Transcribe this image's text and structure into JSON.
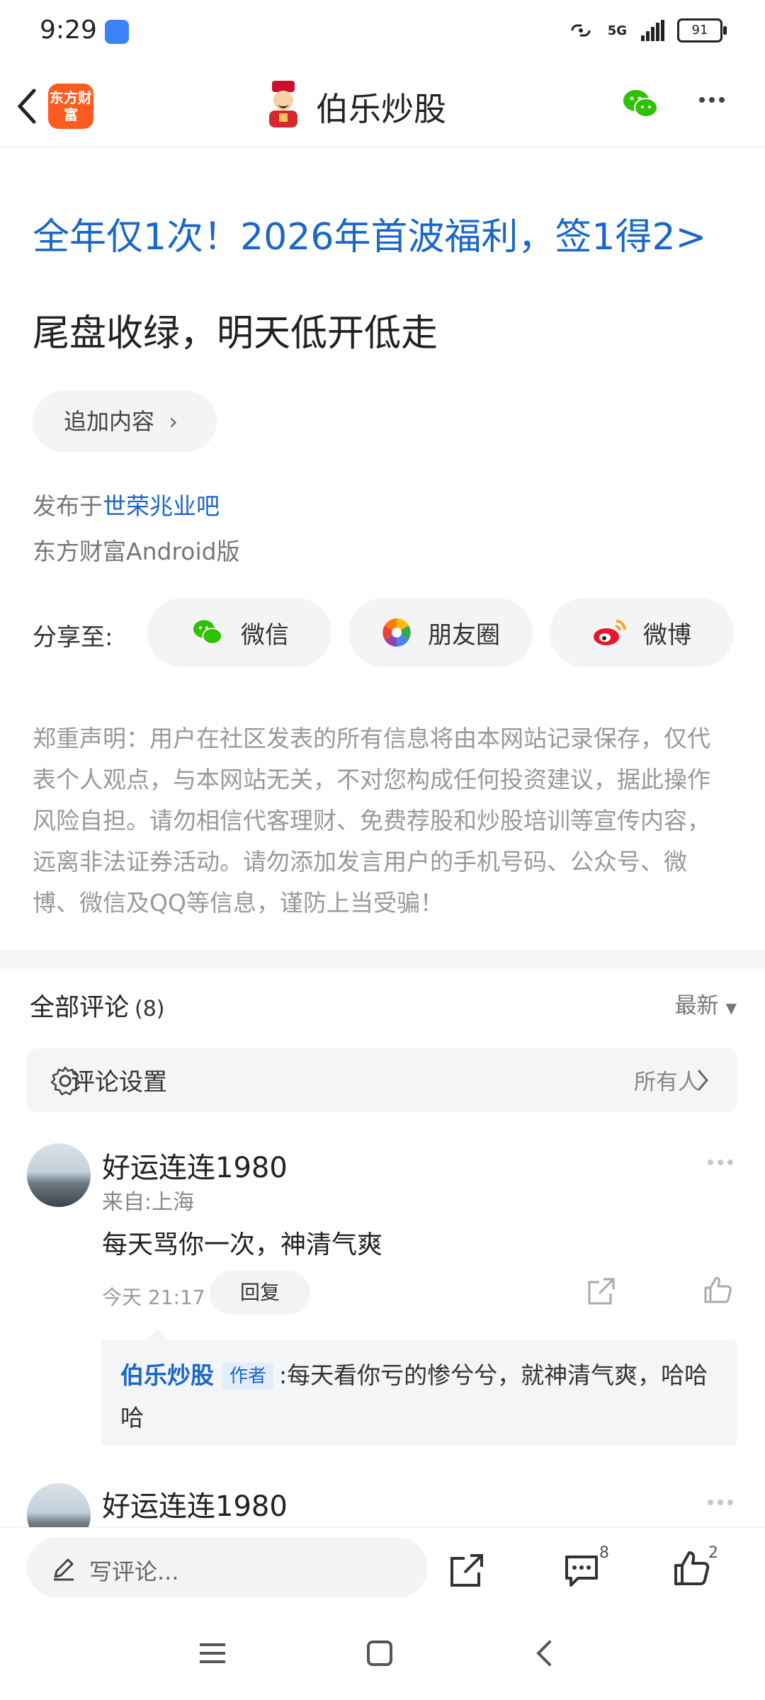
{
  "status_bar": {
    "time": "9:29",
    "network": "5G",
    "battery": "91"
  },
  "header": {
    "logo_text": "东方财富",
    "title": "伯乐炒股"
  },
  "post": {
    "promo": "全年仅1次！2026年首波福利，签1得2>",
    "title": "尾盘收绿，明天低开低走",
    "add_content": "追加内容",
    "published_prefix": "发布于",
    "bar_name": "世荣兆业吧",
    "client": "东方财富Android版"
  },
  "share": {
    "label": "分享至:",
    "items": [
      {
        "label": "微信",
        "icon": "wechat-icon"
      },
      {
        "label": "朋友圈",
        "icon": "moments-icon"
      },
      {
        "label": "微博",
        "icon": "weibo-icon"
      }
    ]
  },
  "disclaimer": "郑重声明：用户在社区发表的所有信息将由本网站记录保存，仅代表个人观点，与本网站无关，不对您构成任何投资建议，据此操作风险自担。请勿相信代客理财、免费荐股和炒股培训等宣传内容，远离非法证券活动。请勿添加发言用户的手机号码、公众号、微博、微信及QQ等信息，谨防上当受骗！",
  "comments": {
    "title": "全部评论",
    "count": "(8)",
    "sort": "最新",
    "settings_label": "评论设置",
    "settings_value": "所有人",
    "items": [
      {
        "user": "好运连连1980",
        "location": "来自:上海",
        "text": "每天骂你一次，神清气爽",
        "time": "今天 21:17",
        "reply_label": "回复",
        "reply": {
          "author": "伯乐炒股",
          "badge": "作者",
          "text": ":每天看你亏的惨兮兮，就神清气爽，哈哈哈"
        }
      },
      {
        "user": "好运连连1980"
      }
    ]
  },
  "bottom": {
    "write_placeholder": "写评论...",
    "comment_count": "8",
    "like_count": "2"
  },
  "colors": {
    "link_blue": "#1a67c9",
    "brand_orange": "#ff5a1f",
    "wechat_green": "#2dc100"
  }
}
